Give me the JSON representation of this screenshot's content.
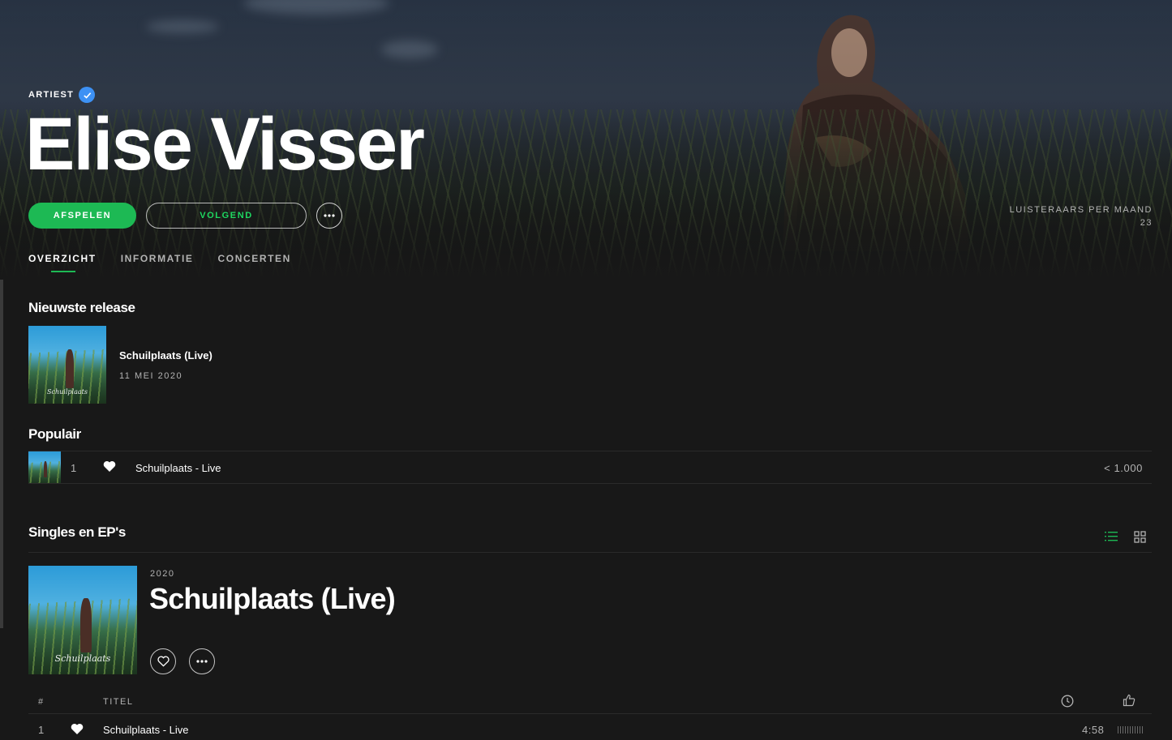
{
  "artist": {
    "label": "ARTIEST",
    "name": "Elise Visser",
    "play_label": "AFSPELEN",
    "follow_label": "VOLGEND",
    "more_label": "•••",
    "listeners_label": "LUISTERAARS PER MAAND",
    "listeners_value": "23"
  },
  "tabs": [
    {
      "label": "OVERZICHT",
      "active": true
    },
    {
      "label": "INFORMATIE",
      "active": false
    },
    {
      "label": "CONCERTEN",
      "active": false
    }
  ],
  "latest": {
    "heading": "Nieuwste release",
    "title": "Schuilplaats (Live)",
    "date": "11 MEI 2020"
  },
  "popular": {
    "heading": "Populair",
    "rows": [
      {
        "num": "1",
        "title": "Schuilplaats - Live",
        "plays": "< 1.000"
      }
    ]
  },
  "singles": {
    "heading": "Singles en EP's",
    "year": "2020",
    "title": "Schuilplaats (Live)",
    "more_label": "•••",
    "columns": {
      "num": "#",
      "title": "TITEL"
    },
    "tracks": [
      {
        "num": "1",
        "title": "Schuilplaats - Live",
        "duration": "4:58"
      }
    ]
  },
  "colors": {
    "accent": "#1db954",
    "verified": "#3d91f4",
    "background": "#181818"
  }
}
